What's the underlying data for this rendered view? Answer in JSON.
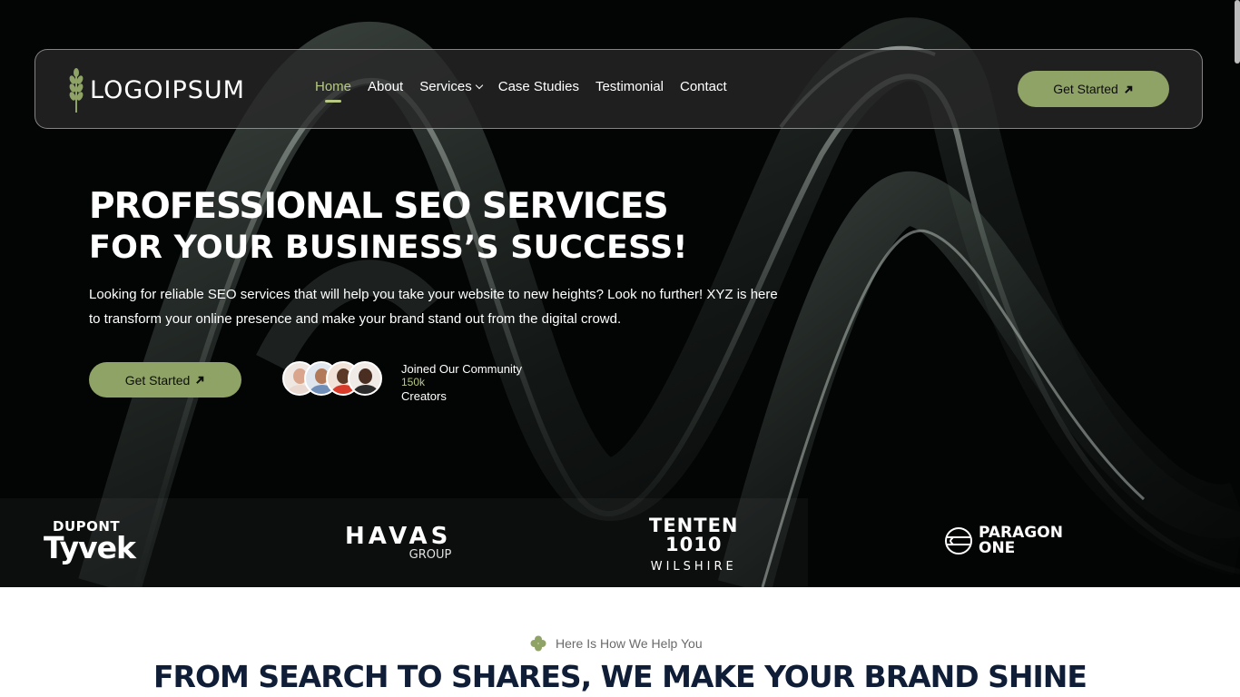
{
  "nav": {
    "logo_text": "LOGOIPSUM",
    "links": [
      "Home",
      "About",
      "Services",
      "Case Studies",
      "Testimonial",
      "Contact"
    ],
    "active": "Home",
    "cta_label": "Get Started"
  },
  "hero": {
    "title_line1": "PROFESSIONAL SEO SERVICES",
    "title_line2": "FOR YOUR BUSINESS’S SUCCESS!",
    "description": "Looking for reliable SEO services that will help you take your website to new heights? Look no further! XYZ is here to transform your online presence and make your brand stand out from the digital crowd.",
    "cta_label": "Get Started",
    "community": {
      "label": "Joined Our Community",
      "count": "150k",
      "unit": "Creators"
    }
  },
  "brands": {
    "tyvek_top": "DUPONT",
    "tyvek_main": "Tyvek",
    "havas_main": "HAVAS",
    "havas_sub": "GROUP",
    "tenten_line1": "TENTEN",
    "tenten_line2": "1010",
    "tenten_sub": "WILSHIRE",
    "paragon_line1": "PARAGON",
    "paragon_line2": "ONE"
  },
  "section": {
    "tag": "Here Is How We Help You",
    "title": "FROM SEARCH TO SHARES, WE MAKE YOUR BRAND SHINE"
  },
  "colors": {
    "accent": "#8fa366",
    "accent_light": "#b7c983",
    "hero_bg": "#030404",
    "title_dark": "#0f1d36"
  },
  "icons": [
    "wheat-logo-icon",
    "chevron-down-icon",
    "arrow-up-right-icon",
    "clover-icon",
    "paragon-globe-icon"
  ]
}
